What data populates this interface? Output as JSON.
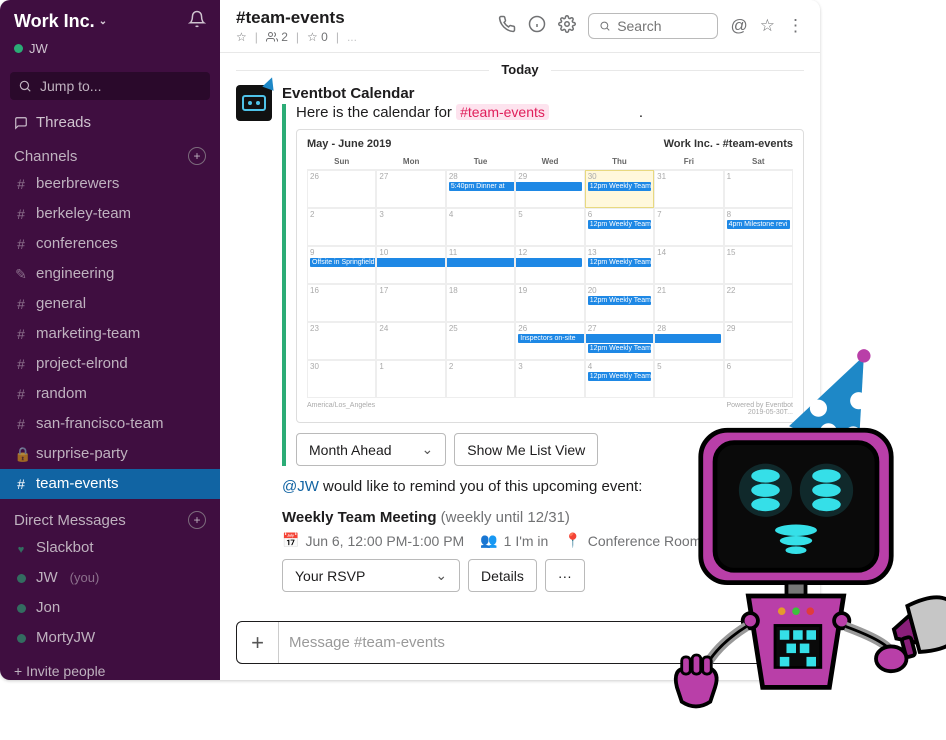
{
  "workspace": {
    "name": "Work Inc.",
    "user_short": "JW"
  },
  "sidebar": {
    "jump_to": "Jump to...",
    "threads": "Threads",
    "channels_label": "Channels",
    "channels": [
      {
        "prefix": "#",
        "name": "beerbrewers"
      },
      {
        "prefix": "#",
        "name": "berkeley-team"
      },
      {
        "prefix": "#",
        "name": "conferences"
      },
      {
        "prefix": "✎",
        "name": "engineering"
      },
      {
        "prefix": "#",
        "name": "general"
      },
      {
        "prefix": "#",
        "name": "marketing-team"
      },
      {
        "prefix": "#",
        "name": "project-elrond"
      },
      {
        "prefix": "#",
        "name": "random"
      },
      {
        "prefix": "#",
        "name": "san-francisco-team"
      },
      {
        "prefix": "🔒",
        "name": "surprise-party"
      },
      {
        "prefix": "#",
        "name": "team-events",
        "active": true
      }
    ],
    "dm_label": "Direct Messages",
    "dms": [
      {
        "name": "Slackbot",
        "presence": "heart"
      },
      {
        "name": "JW",
        "you": "(you)",
        "presence": "online"
      },
      {
        "name": "Jon",
        "presence": "online"
      },
      {
        "name": "MortyJW",
        "presence": "online"
      }
    ],
    "invite": "Invite people"
  },
  "header": {
    "channel": "#team-events",
    "star": "☆",
    "members": "2",
    "pins": "0",
    "search_placeholder": "Search"
  },
  "divider": "Today",
  "message": {
    "author": "Eventbot Calendar",
    "intro_prefix": "Here is the calendar for ",
    "intro_tag": "#team-events",
    "intro_suffix": ".",
    "calendar": {
      "range": "May - June 2019",
      "context": "Work Inc. - #team-events",
      "dow": [
        "Sun",
        "Mon",
        "Tue",
        "Wed",
        "Thu",
        "Fri",
        "Sat"
      ],
      "tz": "America/Los_Angeles",
      "powered": "Powered by Eventbot",
      "generated": "2019-05-30T...",
      "weeks": [
        [
          {
            "d": "26"
          },
          {
            "d": "27"
          },
          {
            "d": "28",
            "ev": [
              {
                "t": "5:40pm Dinner at",
                "s": "start"
              }
            ]
          },
          {
            "d": "29",
            "ev": [
              {
                "t": "",
                "s": "end"
              }
            ]
          },
          {
            "d": "30",
            "today": true,
            "ev": [
              {
                "t": "12pm Weekly Team"
              }
            ]
          },
          {
            "d": "31"
          },
          {
            "d": "1"
          }
        ],
        [
          {
            "d": "2"
          },
          {
            "d": "3"
          },
          {
            "d": "4"
          },
          {
            "d": "5"
          },
          {
            "d": "6",
            "ev": [
              {
                "t": "12pm Weekly Team"
              }
            ]
          },
          {
            "d": "7"
          },
          {
            "d": "8",
            "ev": [
              {
                "t": "4pm Milestone revi"
              }
            ]
          }
        ],
        [
          {
            "d": "9",
            "ev": [
              {
                "t": "Offsite in Springfield",
                "s": "start"
              }
            ]
          },
          {
            "d": "10",
            "ev": [
              {
                "t": "",
                "s": "mid"
              }
            ]
          },
          {
            "d": "11",
            "ev": [
              {
                "t": "",
                "s": "mid"
              }
            ]
          },
          {
            "d": "12",
            "ev": [
              {
                "t": "",
                "s": "end"
              }
            ]
          },
          {
            "d": "13",
            "ev": [
              {
                "t": "12pm Weekly Team"
              }
            ]
          },
          {
            "d": "14"
          },
          {
            "d": "15"
          }
        ],
        [
          {
            "d": "16"
          },
          {
            "d": "17"
          },
          {
            "d": "18"
          },
          {
            "d": "19"
          },
          {
            "d": "20",
            "ev": [
              {
                "t": "12pm Weekly Team"
              }
            ]
          },
          {
            "d": "21"
          },
          {
            "d": "22"
          }
        ],
        [
          {
            "d": "23"
          },
          {
            "d": "24"
          },
          {
            "d": "25"
          },
          {
            "d": "26",
            "ev": [
              {
                "t": "Inspectors on-site",
                "s": "start"
              }
            ]
          },
          {
            "d": "27",
            "ev": [
              {
                "t": "",
                "s": "mid"
              },
              {
                "t": "12pm Weekly Team"
              }
            ]
          },
          {
            "d": "28",
            "ev": [
              {
                "t": "",
                "s": "end"
              }
            ]
          },
          {
            "d": "29"
          }
        ],
        [
          {
            "d": "30"
          },
          {
            "d": "1"
          },
          {
            "d": "2"
          },
          {
            "d": "3"
          },
          {
            "d": "4",
            "ev": [
              {
                "t": "12pm Weekly Team"
              }
            ]
          },
          {
            "d": "5"
          },
          {
            "d": "6"
          }
        ]
      ]
    },
    "btn_month": "Month Ahead",
    "btn_list": "Show Me List View",
    "remind_mention": "@JW",
    "remind_text": " would like to remind you of this upcoming event:"
  },
  "event": {
    "title": "Weekly Team Meeting",
    "recurrence": "(weekly until 12/31)",
    "when": "Jun 6, 12:00 PM-1:00 PM",
    "attend": "1 I'm in",
    "loc": "Conference Room",
    "rsvp": "Your RSVP",
    "details": "Details"
  },
  "composer": {
    "placeholder": "Message #team-events"
  }
}
